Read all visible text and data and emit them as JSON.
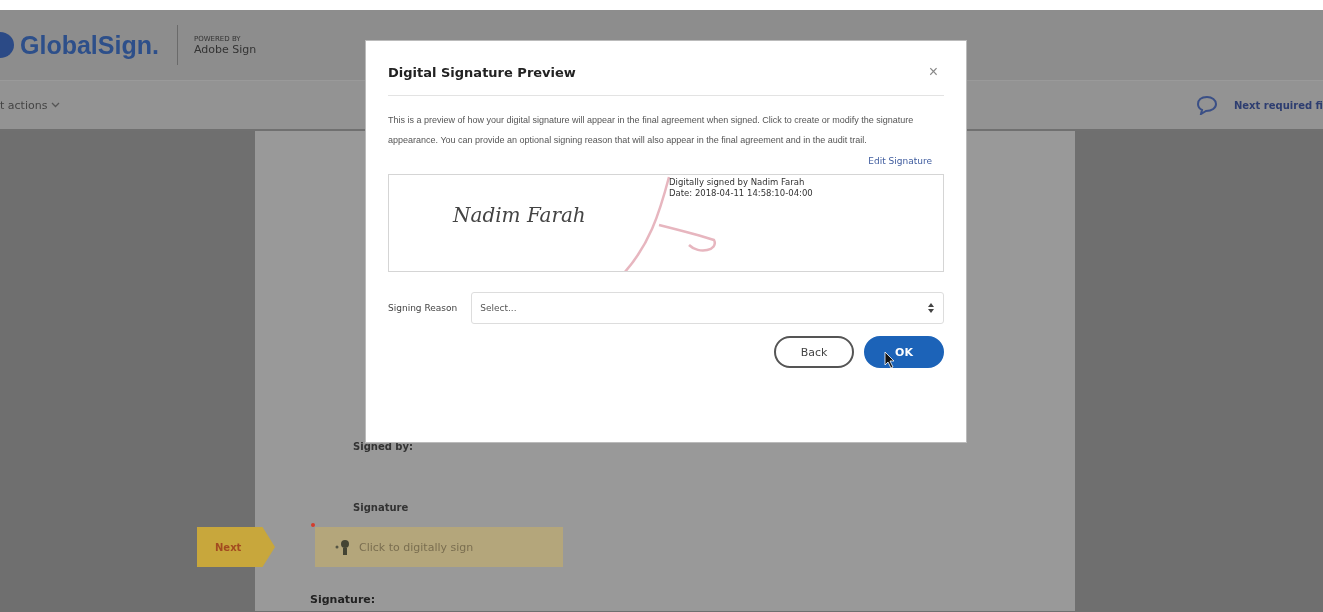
{
  "header": {
    "logo": "GlobalSign.",
    "powered_by": "POWERED BY",
    "partner": "Adobe Sign"
  },
  "toolbar": {
    "actions_menu": "t actions",
    "next_required": "Next required fi"
  },
  "document": {
    "signed_by_label": "Signed by:",
    "signature_label": "Signature",
    "next_tag": "Next",
    "signature_field": {
      "placeholder": "Click to digitally sign",
      "required": true
    },
    "bottom_label": "Signature:"
  },
  "dialog": {
    "title": "Digital Signature Preview",
    "close": "×",
    "description": "This is a preview of how your digital signature will appear in the final agreement when signed. Click to create or modify the signature appearance. You can provide an optional signing reason that will also appear in the final agreement and in the audit trail.",
    "edit_link": "Edit Signature",
    "preview": {
      "name": "Nadim Farah",
      "details": [
        "Digitally signed by Nadim Farah",
        "Date: 2018-04-11 14:58:10-04:00"
      ]
    },
    "signing_reason": {
      "label": "Signing Reason",
      "placeholder": "Select..."
    },
    "buttons": [
      {
        "label": "Back",
        "kind": "secondary"
      },
      {
        "label": "OK",
        "kind": "primary"
      }
    ]
  }
}
